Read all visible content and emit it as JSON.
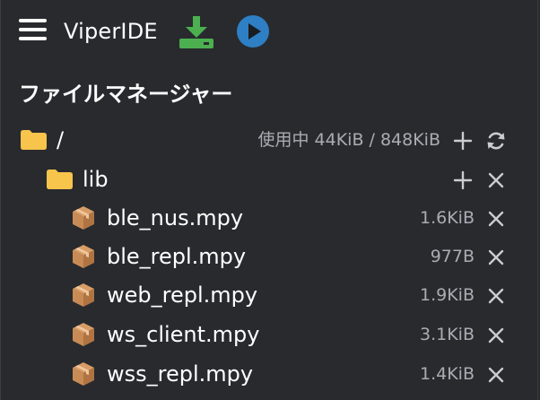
{
  "app": {
    "title": "ViperIDE"
  },
  "toolbar": {
    "menu_icon": "hamburger-menu-icon",
    "download_icon": "download-to-device-icon",
    "run_icon": "play-circle-icon",
    "colors": {
      "download": "#4caf50",
      "run": "#2e7fc4"
    }
  },
  "file_manager": {
    "title": "ファイルマネージャー",
    "root": {
      "name": "/",
      "usage": "使用中 44KiB / 848KiB",
      "icon": "folder-icon",
      "actions": [
        "add-icon",
        "refresh-icon"
      ]
    },
    "folders": [
      {
        "name": "lib",
        "icon": "folder-icon",
        "actions": [
          "add-icon",
          "close-icon"
        ],
        "files": [
          {
            "name": "ble_nus.mpy",
            "size": "1.6KiB",
            "icon": "package-icon"
          },
          {
            "name": "ble_repl.mpy",
            "size": "977B",
            "icon": "package-icon"
          },
          {
            "name": "web_repl.mpy",
            "size": "1.9KiB",
            "icon": "package-icon"
          },
          {
            "name": "ws_client.mpy",
            "size": "3.1KiB",
            "icon": "package-icon"
          },
          {
            "name": "wss_repl.mpy",
            "size": "1.4KiB",
            "icon": "package-icon"
          }
        ]
      }
    ],
    "colors": {
      "folder": "#f7c44c",
      "package": "#c98b55",
      "muted_text": "#a9adb3",
      "background": "#282a2e"
    }
  }
}
